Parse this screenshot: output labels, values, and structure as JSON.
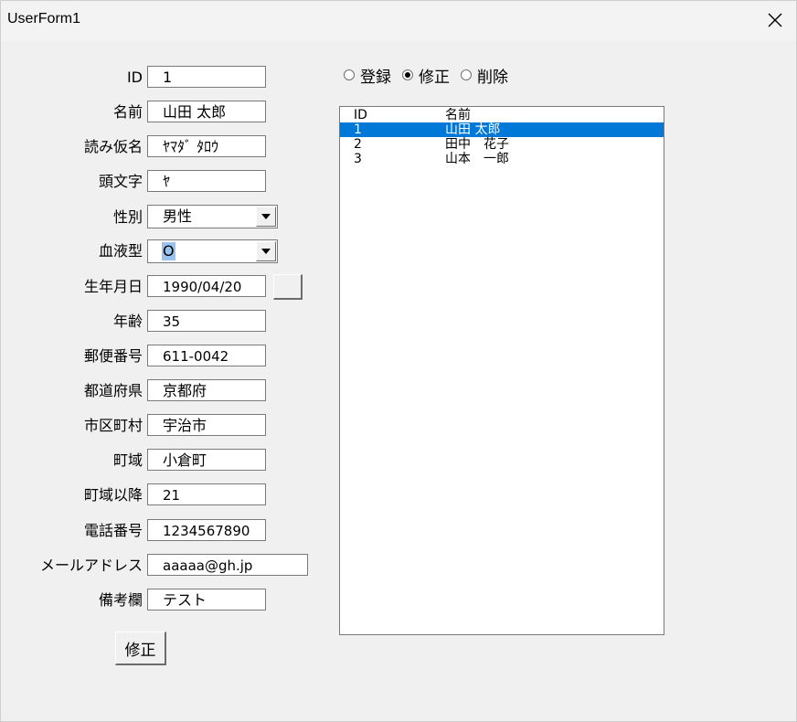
{
  "window": {
    "title": "UserForm1"
  },
  "fields": [
    {
      "label": "ID",
      "value": "1"
    },
    {
      "label": "名前",
      "value": "山田 太郎"
    },
    {
      "label": "読み仮名",
      "value": "ﾔﾏﾀﾞ ﾀﾛｳ"
    },
    {
      "label": "頭文字",
      "value": "ﾔ"
    },
    {
      "label": "性別",
      "value": "男性"
    },
    {
      "label": "血液型",
      "value": "O"
    },
    {
      "label": "生年月日",
      "value": "1990/04/20"
    },
    {
      "label": "年齢",
      "value": "35"
    },
    {
      "label": "郵便番号",
      "value": "611-0042"
    },
    {
      "label": "都道府県",
      "value": "京都府"
    },
    {
      "label": "市区町村",
      "value": "宇治市"
    },
    {
      "label": "町域",
      "value": "小倉町"
    },
    {
      "label": "町域以降",
      "value": "21"
    },
    {
      "label": "電話番号",
      "value": "1234567890"
    },
    {
      "label": "メールアドレス",
      "value": "aaaaa@gh.jp"
    },
    {
      "label": "備考欄",
      "value": "テスト"
    }
  ],
  "modes": [
    {
      "label": "登録",
      "selected": false
    },
    {
      "label": "修正",
      "selected": true
    },
    {
      "label": "削除",
      "selected": false
    }
  ],
  "list": {
    "headers": [
      "ID",
      "名前"
    ],
    "rows": [
      {
        "id": "1",
        "name": "山田 太郎",
        "selected": true
      },
      {
        "id": "2",
        "name": "田中　花子",
        "selected": false
      },
      {
        "id": "3",
        "name": "山本　一郎",
        "selected": false
      }
    ]
  },
  "submit_label": "修正",
  "colors": {
    "selection": "#0078d7",
    "combo_selection": "#99c3ee",
    "background": "#f0f0f0"
  }
}
